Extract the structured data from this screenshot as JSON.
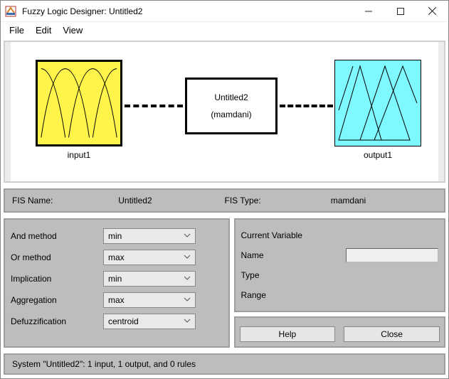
{
  "title": "Fuzzy Logic Designer: Untitled2",
  "menu": {
    "file": "File",
    "edit": "Edit",
    "view": "View"
  },
  "diagram": {
    "input_label": "input1",
    "output_label": "output1",
    "sys_name": "Untitled2",
    "sys_type": "(mamdani)"
  },
  "fis": {
    "name_label": "FIS Name:",
    "name_value": "Untitled2",
    "type_label": "FIS Type:",
    "type_value": "mamdani"
  },
  "methods": {
    "and": {
      "label": "And method",
      "value": "min"
    },
    "or": {
      "label": "Or method",
      "value": "max"
    },
    "imp": {
      "label": "Implication",
      "value": "min"
    },
    "agg": {
      "label": "Aggregation",
      "value": "max"
    },
    "defuzz": {
      "label": "Defuzzification",
      "value": "centroid"
    }
  },
  "currentVar": {
    "heading": "Current Variable",
    "name_label": "Name",
    "name_value": "",
    "type_label": "Type",
    "type_value": "",
    "range_label": "Range",
    "range_value": ""
  },
  "buttons": {
    "help": "Help",
    "close": "Close"
  },
  "status": "System \"Untitled2\": 1 input, 1 output, and 0 rules"
}
